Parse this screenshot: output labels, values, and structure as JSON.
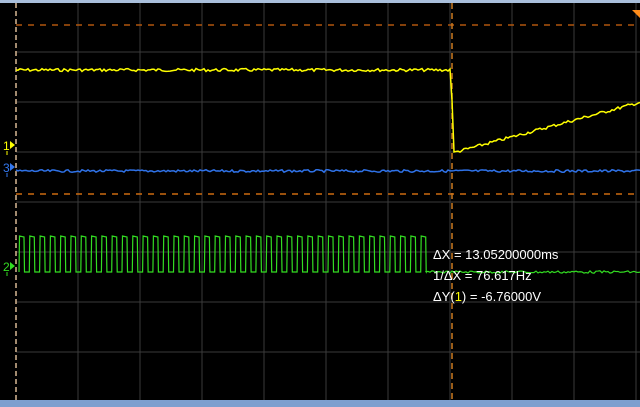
{
  "measurements": {
    "delta_x": "ΔX = 13.05200000ms",
    "inv_delta_x": "1/ΔX = 76.617Hz",
    "delta_y_prefix": "ΔY(",
    "delta_y_channel": "1",
    "delta_y_suffix": ") = -6.76000V"
  },
  "channels": [
    {
      "label": "1",
      "color": "#ffff00"
    },
    {
      "label": "2",
      "color": "#33dd22"
    },
    {
      "label": "3",
      "color": "#3377ee"
    }
  ],
  "colors": {
    "grid": "#3a3a3a",
    "cursor": "#cc6a10",
    "cursor_v": "#d8b894"
  }
}
